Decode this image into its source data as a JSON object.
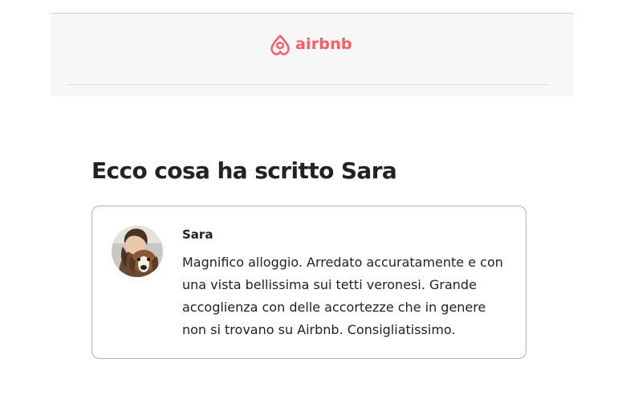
{
  "header": {
    "logo_text": "airbnb",
    "brand_color": "#ff5a5f",
    "logo_icon": "airbnb-belo-icon"
  },
  "main": {
    "heading": "Ecco cosa ha scritto Sara"
  },
  "review": {
    "reviewer_name": "Sara",
    "avatar": "reviewer-avatar-photo",
    "text": "Magnifico alloggio. Arredato accuratamente e con una vista bellissima sui tetti veronesi. Grande accoglienza con delle accortezze che in genere non si trovano su Airbnb. Consigliatissimo."
  }
}
